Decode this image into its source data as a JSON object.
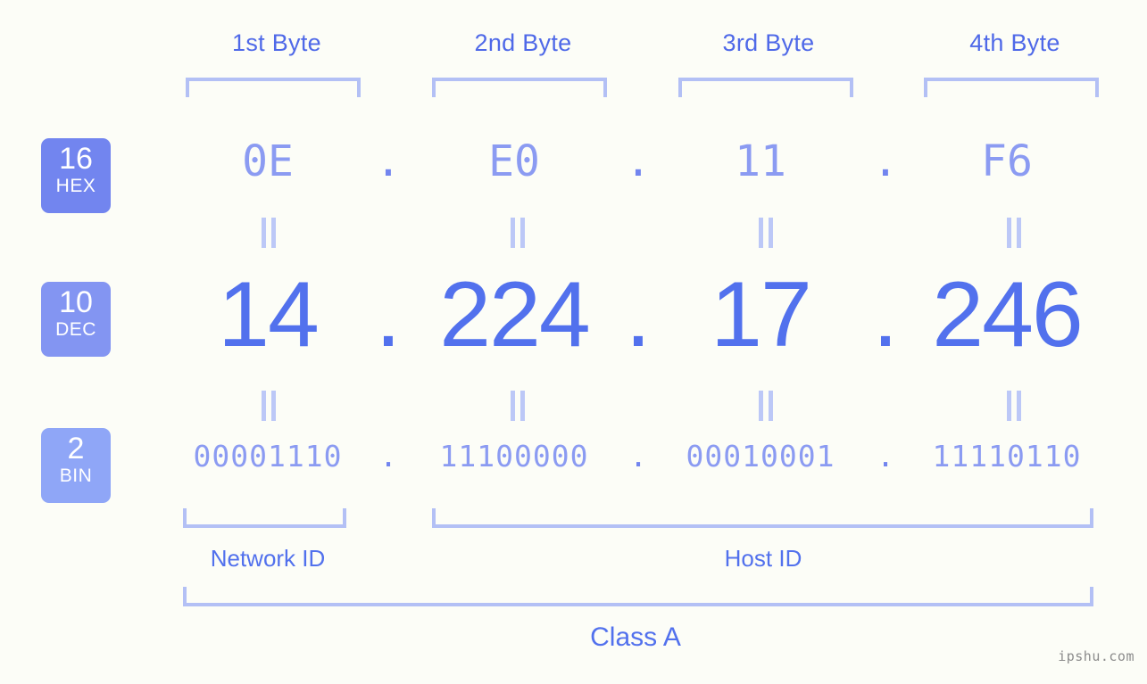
{
  "meta": {
    "watermark": "ipshu.com",
    "background_color": "#fcfdf7",
    "accent_color": "#5271ed",
    "light_accent_color": "#8b9bf2",
    "bracket_color": "#b3c0f5"
  },
  "byte_headers": [
    {
      "label": "1st Byte"
    },
    {
      "label": "2nd Byte"
    },
    {
      "label": "3rd Byte"
    },
    {
      "label": "4th Byte"
    }
  ],
  "bases": [
    {
      "number": "16",
      "name": "HEX",
      "color": "#7285ef"
    },
    {
      "number": "10",
      "name": "DEC",
      "color": "#8395f2"
    },
    {
      "number": "2",
      "name": "BIN",
      "color": "#8fa6f7"
    }
  ],
  "separator": ".",
  "equals_symbol": "=",
  "rows": {
    "hex": {
      "base_label": "HEX",
      "values": [
        "0E",
        "E0",
        "11",
        "F6"
      ],
      "full": "0E.E0.11.F6"
    },
    "dec": {
      "base_label": "DEC",
      "values": [
        "14",
        "224",
        "17",
        "246"
      ],
      "full": "14.224.17.246"
    },
    "bin": {
      "base_label": "BIN",
      "values": [
        "00001110",
        "11100000",
        "00010001",
        "11110110"
      ],
      "full": "00001110.11100000.00010001.11110110"
    }
  },
  "sections": {
    "network_id": "Network ID",
    "host_id": "Host ID",
    "class": "Class A"
  }
}
